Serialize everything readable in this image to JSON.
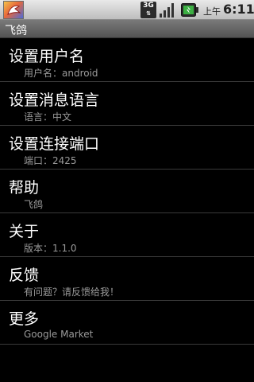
{
  "status_bar": {
    "network_label": "3G",
    "time_suffix": "上午",
    "time": "6:11",
    "icons": [
      "app-notification-icon",
      "3g-data-icon",
      "signal-strength-icon",
      "battery-icon"
    ]
  },
  "title_bar": {
    "title": "飞鸽"
  },
  "preferences": [
    {
      "title": "设置用户名",
      "summary": "用户名：android"
    },
    {
      "title": "设置消息语言",
      "summary": "语言：中文"
    },
    {
      "title": "设置连接端口",
      "summary": "端口：2425"
    },
    {
      "title": "帮助",
      "summary": "飞鸽"
    },
    {
      "title": "关于",
      "summary": "版本：1.1.0"
    },
    {
      "title": "反馈",
      "summary": "有问题？请反馈给我！"
    },
    {
      "title": "更多",
      "summary": "Google Market"
    }
  ],
  "colors": {
    "accent_battery": "#3cb043",
    "list_background": "#000000",
    "summary_text": "#9a9a9a"
  }
}
